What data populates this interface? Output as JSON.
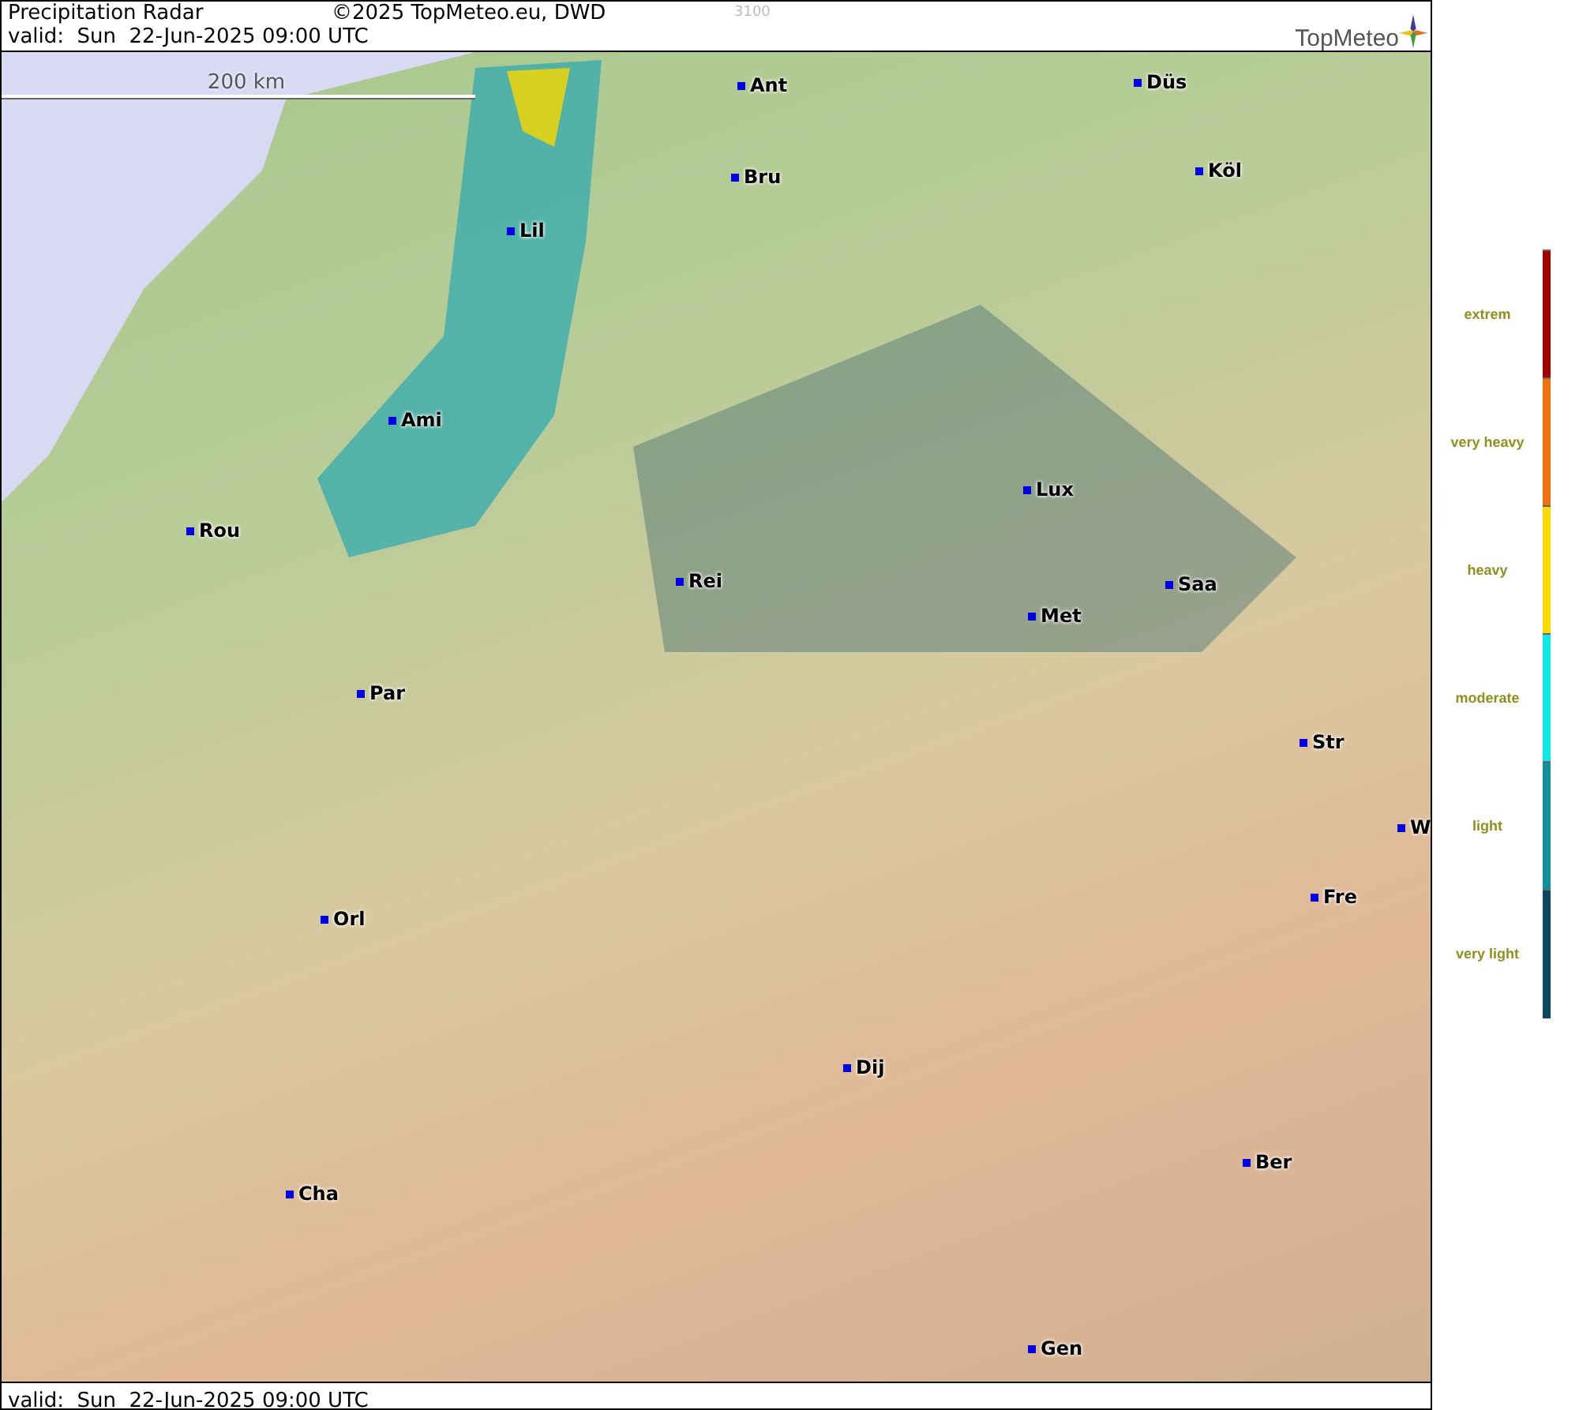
{
  "header": {
    "title": "Precipitation Radar",
    "copyright": "©2025 TopMeteo.eu, DWD",
    "code": "3100",
    "valid": "valid:  Sun  22-Jun-2025 09:00 UTC",
    "logo": "TopMeteo"
  },
  "map": {
    "scale": "200 km",
    "cities": [
      {
        "name": "Ant"
      },
      {
        "name": "Düs"
      },
      {
        "name": "Bru"
      },
      {
        "name": "Köl"
      },
      {
        "name": "Lil"
      },
      {
        "name": "Ami"
      },
      {
        "name": "Rou"
      },
      {
        "name": "Lux"
      },
      {
        "name": "Rei"
      },
      {
        "name": "Saa"
      },
      {
        "name": "Met"
      },
      {
        "name": "Par"
      },
      {
        "name": "Str"
      },
      {
        "name": "W"
      },
      {
        "name": "Fre"
      },
      {
        "name": "Orl"
      },
      {
        "name": "Dij"
      },
      {
        "name": "Ber"
      },
      {
        "name": "Cha"
      },
      {
        "name": "Gen"
      }
    ]
  },
  "footer": {
    "valid": "valid:  Sun  22-Jun-2025 09:00 UTC"
  },
  "legend": [
    {
      "label": "extrem",
      "color": "#a00000"
    },
    {
      "label": "very heavy",
      "color": "#f07010"
    },
    {
      "label": "heavy",
      "color": "#ffd800"
    },
    {
      "label": "moderate",
      "color": "#10e8e8"
    },
    {
      "label": "light",
      "color": "#10909c"
    },
    {
      "label": "very light",
      "color": "#0c4860"
    }
  ]
}
